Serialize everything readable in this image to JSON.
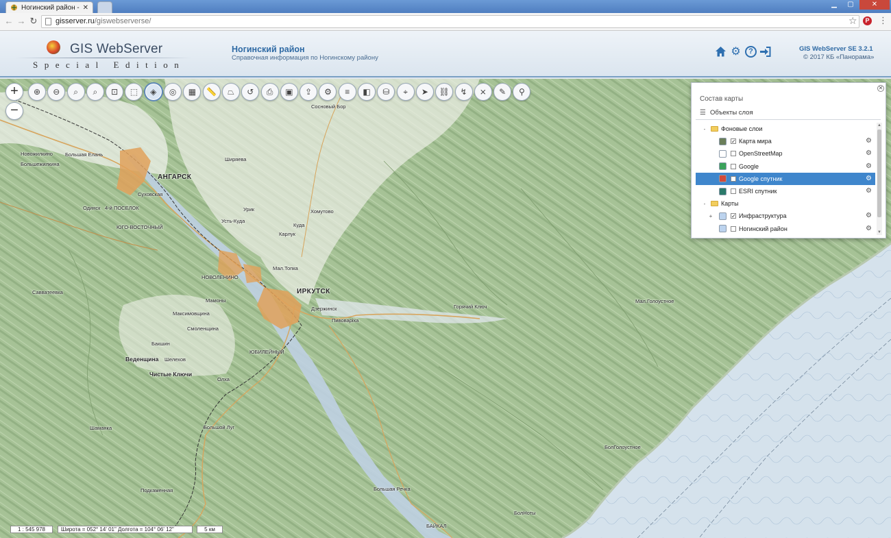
{
  "browser": {
    "tab_title": "Ногинский район - GIS",
    "url_host": "gisserver.ru",
    "url_path": "/giswebserverse/"
  },
  "header": {
    "logo_title": "GIS WebServer",
    "logo_subtitle": "Special Edition",
    "title": "Ногинский район",
    "subtitle": "Справочная информация по Ногинскому району",
    "version": "GIS WebServer SE 3.2.1",
    "copyright": "© 2017 КБ «Панорама»",
    "icons": [
      "home-icon",
      "settings-icon",
      "help-icon",
      "login-icon"
    ]
  },
  "toolbar": {
    "zoom_in": "+",
    "zoom_out": "−",
    "tools": [
      {
        "name": "zoom-in-area-button",
        "glyph": "⊕"
      },
      {
        "name": "zoom-out-area-button",
        "glyph": "⊖"
      },
      {
        "name": "zoom-full-button",
        "glyph": "⌕"
      },
      {
        "name": "zoom-window-button",
        "glyph": "⌕"
      },
      {
        "name": "zoom-selection-button",
        "glyph": "⊡"
      },
      {
        "name": "clear-selection-button",
        "glyph": "⬚"
      },
      {
        "name": "layers-button",
        "glyph": "◈",
        "active": true
      },
      {
        "name": "map-view-button",
        "glyph": "◎"
      },
      {
        "name": "map-grid-button",
        "glyph": "▦"
      },
      {
        "name": "ruler-button",
        "glyph": "📏"
      },
      {
        "name": "area-measure-button",
        "glyph": "⏢"
      },
      {
        "name": "route-button",
        "glyph": "↺"
      },
      {
        "name": "print-button",
        "glyph": "⎙"
      },
      {
        "name": "export-image-button",
        "glyph": "▣"
      },
      {
        "name": "share-button",
        "glyph": "⇪"
      },
      {
        "name": "settings-tool-button",
        "glyph": "⚙"
      },
      {
        "name": "list-button",
        "glyph": "≡"
      },
      {
        "name": "thematic-button",
        "glyph": "◧"
      },
      {
        "name": "storage-button",
        "glyph": "⛁"
      },
      {
        "name": "marker-button",
        "glyph": "⌖"
      },
      {
        "name": "navigate-button",
        "glyph": "➤"
      },
      {
        "name": "network-button",
        "glyph": "⛓"
      },
      {
        "name": "routing-button",
        "glyph": "↯"
      },
      {
        "name": "cancel-route-button",
        "glyph": "⨯"
      },
      {
        "name": "draw-button",
        "glyph": "✎"
      },
      {
        "name": "locate-button",
        "glyph": "⚲"
      }
    ]
  },
  "layer_panel": {
    "title": "Состав карты",
    "subhead": "Объекты слоя",
    "items": [
      {
        "label": "Фоновые слои",
        "type": "folder",
        "toggle": "-",
        "level": 0
      },
      {
        "label": "Карта мира",
        "type": "layer",
        "checked": true,
        "level": 1,
        "icon_color": "#6b7f5a"
      },
      {
        "label": "OpenStreetMap",
        "type": "layer",
        "checked": false,
        "level": 1,
        "icon_color": "#ffffff"
      },
      {
        "label": "Google",
        "type": "layer",
        "checked": false,
        "level": 1,
        "icon_color": "#3aa35b"
      },
      {
        "label": "Google спутник",
        "type": "layer",
        "checked": false,
        "level": 1,
        "icon_color": "#d24a3b",
        "selected": true
      },
      {
        "label": "ESRI спутник",
        "type": "layer",
        "checked": false,
        "level": 1,
        "icon_color": "#2b7a6a"
      },
      {
        "label": "Карты",
        "type": "folder",
        "toggle": "-",
        "level": 0
      },
      {
        "label": "Инфраструктура",
        "type": "layer",
        "checked": true,
        "level": 1,
        "toggle": "+",
        "icon_color": "#bcd3ee"
      },
      {
        "label": "Ногинский район",
        "type": "layer",
        "checked": false,
        "level": 1,
        "icon_color": "#bcd3ee"
      }
    ]
  },
  "map": {
    "labels": [
      {
        "text": "Сосновый Бор",
        "kind": "village"
      },
      {
        "text": "Новожилкино",
        "kind": "village"
      },
      {
        "text": "Большая Елань",
        "kind": "village"
      },
      {
        "text": "Большежилкина",
        "kind": "village"
      },
      {
        "text": "АНГАРСК",
        "kind": "city"
      },
      {
        "text": "Суховская",
        "kind": "village"
      },
      {
        "text": "Одинск",
        "kind": "village"
      },
      {
        "text": "4-й ПОСЕЛОК",
        "kind": "village"
      },
      {
        "text": "ЮГО-ВОСТОЧНЫЙ",
        "kind": "village"
      },
      {
        "text": "Ширяева",
        "kind": "village"
      },
      {
        "text": "Урик",
        "kind": "village"
      },
      {
        "text": "Усть-Куда",
        "kind": "village"
      },
      {
        "text": "Хомутово",
        "kind": "village"
      },
      {
        "text": "Куда",
        "kind": "village"
      },
      {
        "text": "Карлук",
        "kind": "village"
      },
      {
        "text": "Мал.Топка",
        "kind": "village"
      },
      {
        "text": "НОВОЛЕНИНО",
        "kind": "village"
      },
      {
        "text": "ИРКУТСК",
        "kind": "city"
      },
      {
        "text": "Дзержинск",
        "kind": "village"
      },
      {
        "text": "Пивоварiха",
        "kind": "village"
      },
      {
        "text": "Мамоны",
        "kind": "village"
      },
      {
        "text": "Максимовщина",
        "kind": "village"
      },
      {
        "text": "Смоленщина",
        "kind": "village"
      },
      {
        "text": "Бакшин",
        "kind": "village"
      },
      {
        "text": "Веденщина",
        "kind": "village"
      },
      {
        "text": "Шелехов",
        "kind": "village"
      },
      {
        "text": "ЮБИЛЕЙНЫЙ",
        "kind": "village"
      },
      {
        "text": "Чистые Ключи",
        "kind": "village"
      },
      {
        "text": "Олха",
        "kind": "village"
      },
      {
        "text": "Савватеевка",
        "kind": "village"
      },
      {
        "text": "Горячий Ключ",
        "kind": "village"
      },
      {
        "text": "Мал.Голоустное",
        "kind": "village"
      },
      {
        "text": "Шаманка",
        "kind": "village"
      },
      {
        "text": "Большой Луг",
        "kind": "village"
      },
      {
        "text": "БолГолоустное",
        "kind": "village"
      },
      {
        "text": "Подкаменная",
        "kind": "village"
      },
      {
        "text": "Большая Речка",
        "kind": "village"
      },
      {
        "text": "БолНоты",
        "kind": "village"
      },
      {
        "text": "БАЙКАЛ",
        "kind": "village"
      }
    ]
  },
  "status": {
    "scale": "1 : 545 978",
    "coords": "Широта = 052° 14' 01\" Долгота = 104° 06' 12\"",
    "scalebar": "5 км"
  }
}
